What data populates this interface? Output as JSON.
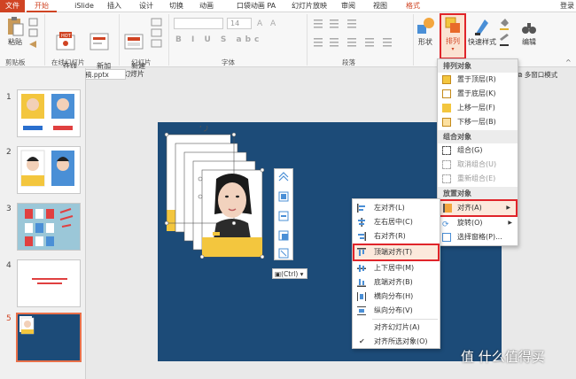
{
  "menu": {
    "file": "文件",
    "tabs": [
      "开始",
      "iSlide",
      "插入",
      "设计",
      "切换",
      "动画",
      "口袋动画 PA",
      "幻灯片放映",
      "审阅",
      "视图",
      "格式"
    ],
    "login": "登录"
  },
  "ribbon": {
    "paste": "粘贴",
    "online_slides": "在线\n幻灯片",
    "new_online_page": "新加\n幻灯页",
    "new_slide": "新建\n幻灯片",
    "font_size": "14",
    "shape": "形状",
    "arrange": "排列",
    "quick_styles": "快速样式",
    "edit": "编辑",
    "groups": {
      "clipboard": "剪贴板",
      "online_slides": "在线幻灯片",
      "slides": "幻灯片",
      "font": "字体",
      "paragraph": "段落"
    }
  },
  "doc_tab": {
    "title": "新建 PPTX 演示文稿.pptx",
    "multi_window": "多窗口模式"
  },
  "slides": [
    {
      "num": "1"
    },
    {
      "num": "2"
    },
    {
      "num": "3"
    },
    {
      "num": "4"
    },
    {
      "num": "5"
    }
  ],
  "ctrl_tag": "(Ctrl)",
  "arrange_menu": {
    "sections": {
      "order": "排列对象",
      "group": "组合对象",
      "position": "放置对象"
    },
    "order_items": [
      "置于顶层(R)",
      "置于底层(K)",
      "上移一层(F)",
      "下移一层(B)"
    ],
    "group_items": [
      "组合(G)",
      "取消组合(U)",
      "重新组合(E)"
    ],
    "position_items": [
      "对齐(A)",
      "旋转(O)",
      "选择窗格(P)..."
    ]
  },
  "align_menu": {
    "items": [
      "左对齐(L)",
      "左右居中(C)",
      "右对齐(R)",
      "顶端对齐(T)",
      "上下居中(M)",
      "底端对齐(B)",
      "横向分布(H)",
      "纵向分布(V)",
      "对齐幻灯片(A)",
      "对齐所选对象(O)"
    ]
  },
  "watermark": "值 什么值得买",
  "colors": {
    "accent": "#d04423",
    "slide_bg": "#1c4b78",
    "highlight": "#e0242a",
    "photo_yellow": "#f3c63e"
  }
}
